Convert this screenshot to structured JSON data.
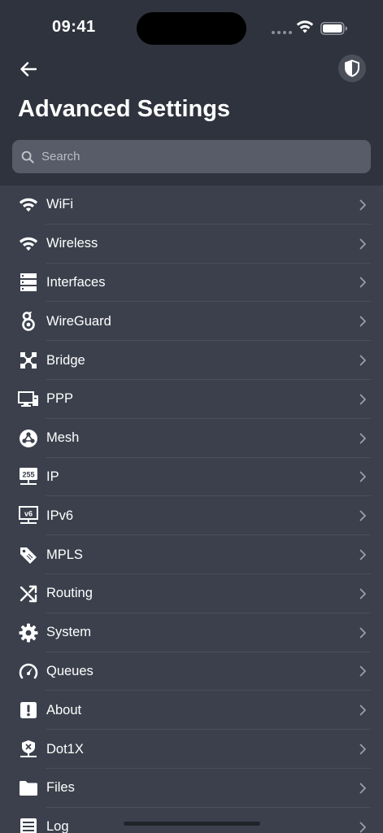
{
  "status_bar": {
    "time": "09:41"
  },
  "header": {
    "title": "Advanced Settings",
    "back_icon": "arrow-left-icon",
    "shield_icon": "shield-icon"
  },
  "search": {
    "placeholder": "Search",
    "value": ""
  },
  "menu": {
    "items": [
      {
        "label": "WiFi",
        "icon": "wifi-icon"
      },
      {
        "label": "Wireless",
        "icon": "wireless-icon"
      },
      {
        "label": "Interfaces",
        "icon": "interfaces-icon"
      },
      {
        "label": "WireGuard",
        "icon": "wireguard-icon"
      },
      {
        "label": "Bridge",
        "icon": "bridge-icon"
      },
      {
        "label": "PPP",
        "icon": "ppp-icon"
      },
      {
        "label": "Mesh",
        "icon": "mesh-icon"
      },
      {
        "label": "IP",
        "icon": "ip-icon",
        "badge": "255"
      },
      {
        "label": "IPv6",
        "icon": "ipv6-icon",
        "badge": "v6"
      },
      {
        "label": "MPLS",
        "icon": "mpls-icon"
      },
      {
        "label": "Routing",
        "icon": "routing-icon"
      },
      {
        "label": "System",
        "icon": "gear-icon"
      },
      {
        "label": "Queues",
        "icon": "gauge-icon"
      },
      {
        "label": "About",
        "icon": "exclamation-icon"
      },
      {
        "label": "Dot1X",
        "icon": "dot1x-icon"
      },
      {
        "label": "Files",
        "icon": "folder-icon"
      },
      {
        "label": "Log",
        "icon": "log-icon"
      }
    ]
  },
  "colors": {
    "header_background": "#2f333d",
    "list_background": "#3b404c",
    "search_background": "#575c68",
    "text": "#ffffff",
    "chevron": "#9a9ea8"
  }
}
